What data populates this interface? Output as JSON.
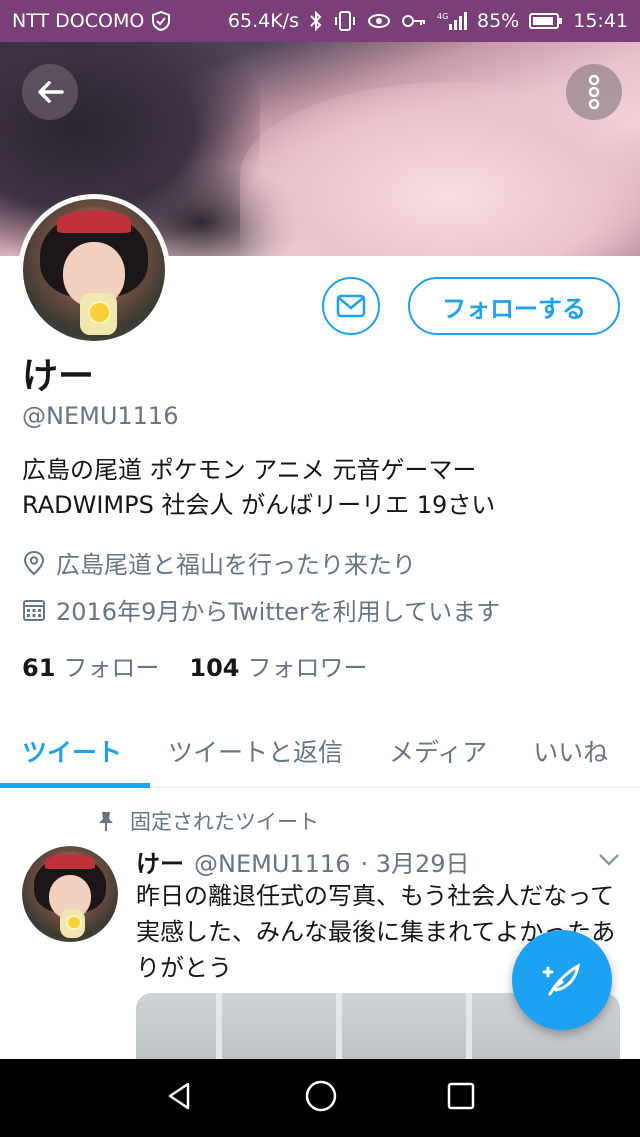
{
  "status_bar": {
    "carrier": "NTT DOCOMO",
    "speed": "65.4K/s",
    "network": "4G",
    "battery": "85%",
    "time": "15:41"
  },
  "profile": {
    "name": "けー",
    "handle": "@NEMU1116",
    "bio": "広島の尾道 ポケモン アニメ 元音ゲーマー\nRADWIMPS  社会人  がんばリーリエ 19さい",
    "location": "広島尾道と福山を行ったり来たり",
    "joined": "2016年9月からTwitterを利用しています",
    "following_count": "61",
    "following_label": "フォロー",
    "followers_count": "104",
    "followers_label": "フォロワー",
    "follow_button": "フォローする"
  },
  "tabs": [
    {
      "label": "ツイート",
      "active": true
    },
    {
      "label": "ツイートと返信",
      "active": false
    },
    {
      "label": "メディア",
      "active": false
    },
    {
      "label": "いいね",
      "active": false
    }
  ],
  "tweet": {
    "pinned_label": "固定されたツイート",
    "name": "けー",
    "handle": "@NEMU1116",
    "date": "· 3月29日",
    "text": "昨日の離退任式の写真、もう社会人だなって実感した、みんな最後に集まれてよかったありがとう"
  },
  "colors": {
    "accent": "#1da1f2",
    "status_bar": "#7a3f78",
    "secondary_text": "#657786"
  }
}
